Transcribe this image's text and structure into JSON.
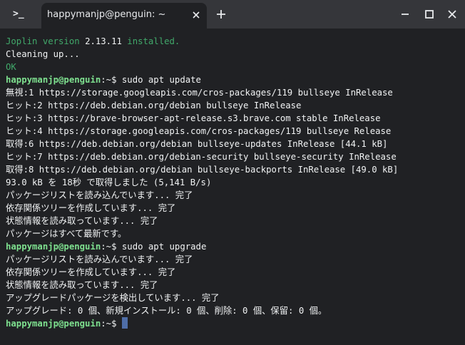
{
  "window": {
    "tab_title": "happymanjp@penguin: ~",
    "icon_glyph": ">_",
    "icons": {
      "app": "terminal-icon",
      "close_tab": "close-icon",
      "new_tab": "plus-icon",
      "minimize": "minimize-icon",
      "maximize": "maximize-icon",
      "close": "close-icon"
    }
  },
  "prompt": {
    "user": "happymanjp@penguin",
    "path": ":~$"
  },
  "lines": {
    "l0_a": "Joplin version ",
    "l0_b": "2.13.11",
    "l0_c": " installed.",
    "l1": "Cleaning up...",
    "l2": "OK",
    "l3_cmd": " sudo apt update",
    "l4": "無視:1 https://storage.googleapis.com/cros-packages/119 bullseye InRelease",
    "l5": "ヒット:2 https://deb.debian.org/debian bullseye InRelease",
    "l6": "ヒット:3 https://brave-browser-apt-release.s3.brave.com stable InRelease",
    "l7": "ヒット:4 https://storage.googleapis.com/cros-packages/119 bullseye Release",
    "l8": "取得:6 https://deb.debian.org/debian bullseye-updates InRelease [44.1 kB]",
    "l9": "ヒット:7 https://deb.debian.org/debian-security bullseye-security InRelease",
    "l10": "取得:8 https://deb.debian.org/debian bullseye-backports InRelease [49.0 kB]",
    "l11": "93.0 kB を 18秒 で取得しました (5,141 B/s)",
    "l12": "パッケージリストを読み込んでいます... 完了",
    "l13": "依存関係ツリーを作成しています... 完了",
    "l14": "状態情報を読み取っています... 完了",
    "l15": "パッケージはすべて最新です。",
    "l16_cmd": " sudo apt upgrade",
    "l17": "パッケージリストを読み込んでいます... 完了",
    "l18": "依存関係ツリーを作成しています... 完了",
    "l19": "状態情報を読み取っています... 完了",
    "l20": "アップグレードパッケージを検出しています... 完了",
    "l21": "アップグレード: 0 個、新規インストール: 0 個、削除: 0 個、保留: 0 個。"
  },
  "colors": {
    "background": "#202124",
    "titlebar": "#35363a",
    "text": "#f1f3f4",
    "prompt_user": "#7ee08f",
    "dim_green": "#41a86a",
    "cursor": "#4f6ea8"
  }
}
